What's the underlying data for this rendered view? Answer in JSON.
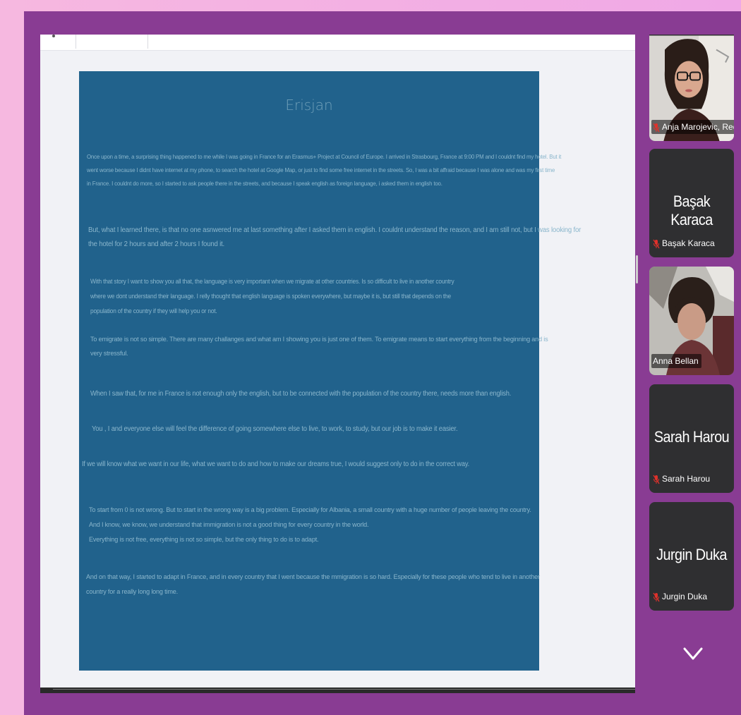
{
  "document": {
    "title": "Erisjan",
    "p1": [
      "Once upon a time, a surprising thing happened to me while I was going in France for an Erasmus+ Project at Council of Europe. I arrived in Strasbourg, France at 9:00 PM and I couldnt find my hotel. But it",
      "went worse because I didnt have internet at my phone, to search the hotel at Google Map, or just to find some free internet in the streets. So, I was a bit affraid because I was alone and was my first time",
      "in France. I couldnt do more, so I started to ask people there in the streets, and because I speak english as foreign language, i asked them in english too."
    ],
    "p2": [
      "But, what I learned there, is that no one asnwered me at last something after I asked them in english. I couldnt understand the reason, and I am still not, but I was looking for",
      "the hotel for 2 hours and after 2 hours I found it."
    ],
    "p3": [
      "With that story I want to show you all that, the language is very important when we migrate at other countries. Is so difficult to live in another country",
      "where we dont understand their language. I relly thought that english language is spoken everywhere, but maybe it is, but still that depends on the",
      "population of the country if they will help you or not."
    ],
    "p4": [
      "To emigrate is not so simple. There are many challanges and what am I showing you is just one of them. To emigrate means to start everything from the beginning and is",
      "very stressful."
    ],
    "p5": "When I saw that, for me in France is not enough only the english, but to be connected with the population of the country there, needs more than english.",
    "p6": "You , I and everyone else will feel the difference of going somewhere else to live, to work, to study, but our job is to make it easier.",
    "p7": "If we will know what we want in our life, what we want to do and how to make our dreams true, I would suggest only to do in the correct way.",
    "p8": [
      "To start from 0 is not wrong. But to start in the wrong way is a big problem. Especially for Albania, a small country with a huge number of people leaving the country.",
      "And I know, we know, we understand that immigration is not a good thing for every country in the world.",
      "Everything is not free, everything is not so simple, but the only thing to do is to adapt."
    ],
    "p9": [
      "And on that way, I started to adapt in France, and in every country that I went because the mmigration is so hard.  Especially for these people who tend to live in another",
      "country for a really long long time."
    ]
  },
  "participants": [
    {
      "name": "Anja Marojevic, Redial",
      "video": true,
      "muted": true
    },
    {
      "name": "Başak Karaca",
      "display_name": "Başak Karaca",
      "video": false,
      "muted": true
    },
    {
      "name": "Anna Bellan",
      "video": true,
      "muted": false
    },
    {
      "name": "Sarah Harou",
      "display_name": "Sarah Harou",
      "video": false,
      "muted": true
    },
    {
      "name": "Jurgin Duka",
      "display_name": "Jurgin Duka",
      "video": false,
      "muted": true
    }
  ],
  "colors": {
    "outer_frame": "#893c93",
    "slide_background": "#21628c",
    "tile_background": "#2f2f31",
    "mute_icon": "#e0312a"
  },
  "icons": {
    "more_participants": "chevron-down-icon",
    "muted": "mic-muted-icon"
  }
}
